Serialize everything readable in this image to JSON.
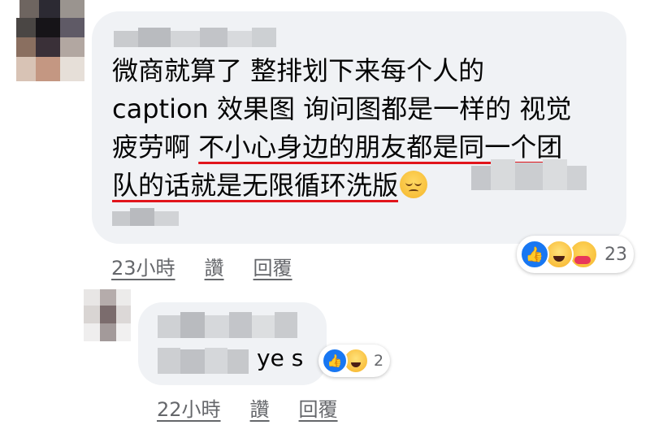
{
  "comment1": {
    "text_lines": [
      "微商就算了 整排划下来每个人的",
      "caption 效果图 询问图都是一样的 视觉",
      "疲劳啊 "
    ],
    "underlined_line3": "不小心身边的朋友都是同一个团",
    "underlined_line4": "队的话就是无限循环洗版",
    "emoji": "relieved-face-emoji",
    "time": "23小時",
    "like_label": "讚",
    "reply_label": "回覆",
    "reaction_count": "23",
    "reaction_icons": [
      "like-icon",
      "haha-icon",
      "care-icon"
    ]
  },
  "comment2": {
    "text": "ye s",
    "time": "22小時",
    "like_label": "讚",
    "reply_label": "回覆",
    "reaction_count": "2",
    "reaction_icons": [
      "like-icon",
      "haha-icon"
    ]
  },
  "colors": {
    "bubble": "#f0f2f5",
    "underline": "#e1151c",
    "meta": "#65676b",
    "like": "#1877f2"
  }
}
